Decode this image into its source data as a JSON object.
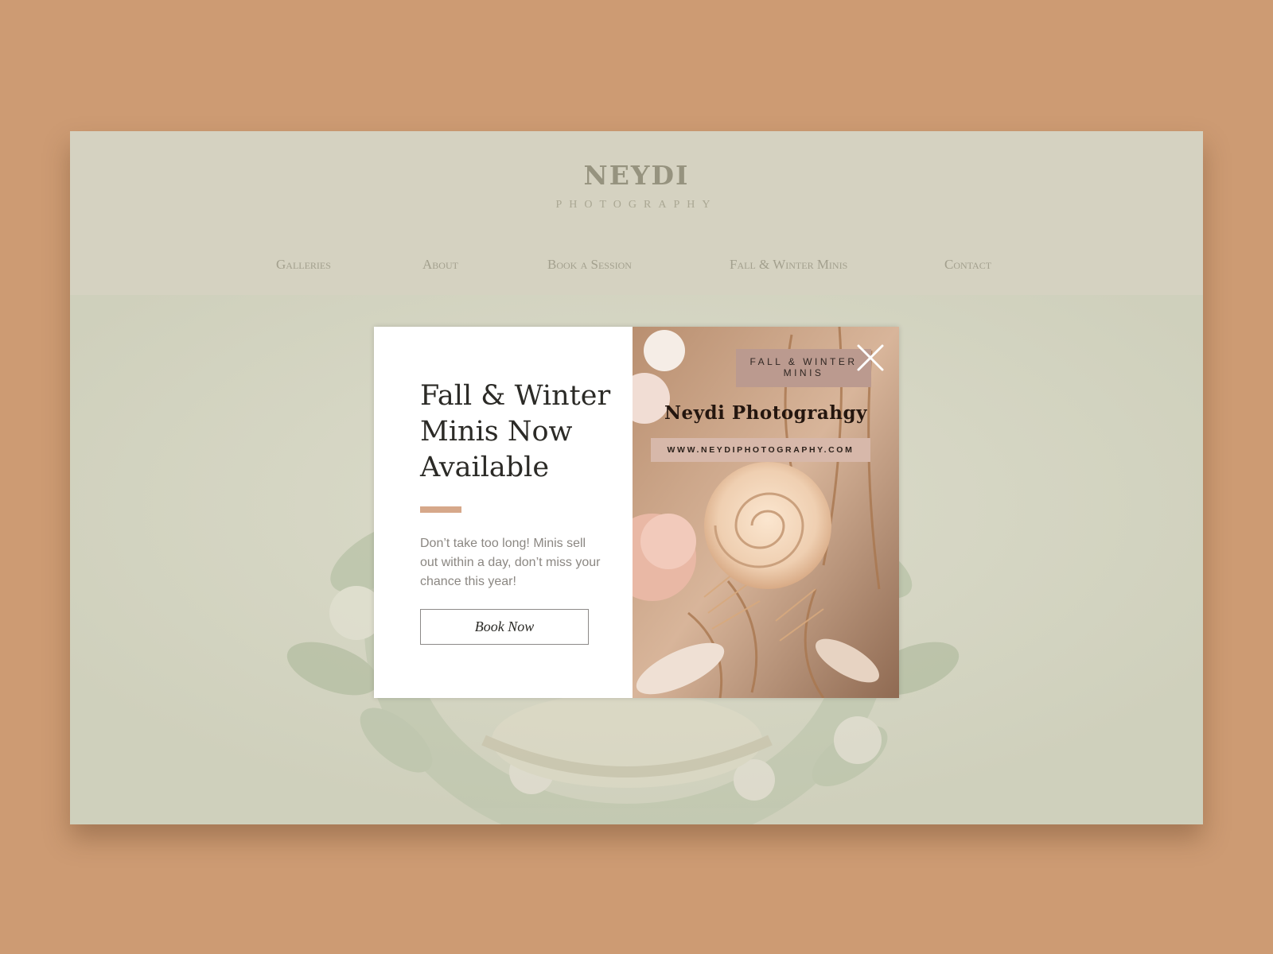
{
  "site": {
    "logo": {
      "name": "NEYDI",
      "tagline": "PHOTOGRAPHY"
    },
    "nav": {
      "items": [
        {
          "label": "Galleries"
        },
        {
          "label": "About"
        },
        {
          "label": "Book a Session"
        },
        {
          "label": "Fall & Winter Minis"
        },
        {
          "label": "Contact"
        }
      ]
    }
  },
  "modal": {
    "title_line1": "Fall & Winter",
    "title_line2": "Minis Now",
    "title_line3": "Available",
    "body": "Don’t take too long! Minis sell out within a day, don’t miss your chance this year!",
    "button_label": "Book Now",
    "promo": {
      "tag_line1": "FALL & WINTER",
      "tag_line2": "MINIS",
      "name": "Neydi Photograhgy",
      "url": "WWW.NEYDIPHOTOGRAPHY.COM"
    },
    "close_icon": "close-icon"
  },
  "colors": {
    "page_background": "#cd9b73",
    "site_background": "#d5d2c1",
    "accent": "#d6a88a"
  }
}
